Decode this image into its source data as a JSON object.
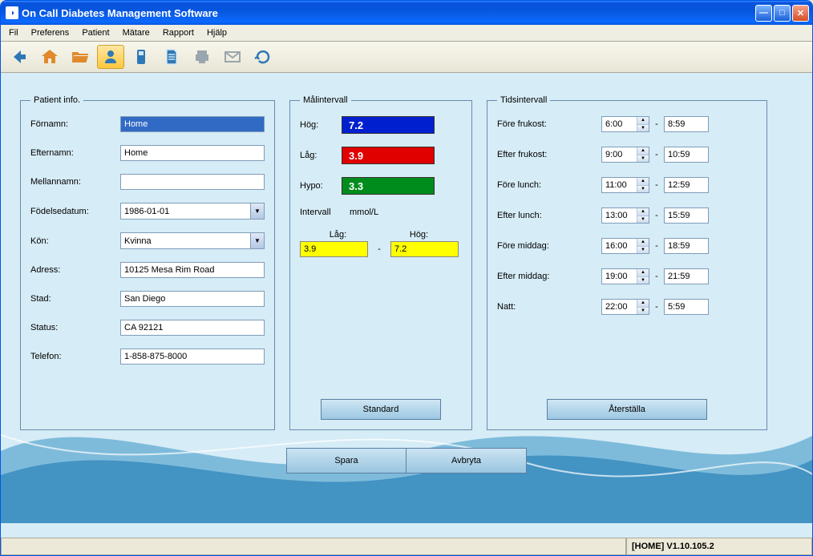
{
  "window": {
    "title": "On Call Diabetes Management Software"
  },
  "menu": {
    "fil": "Fil",
    "preferens": "Preferens",
    "patient": "Patient",
    "matare": "Mätare",
    "rapport": "Rapport",
    "hjalp": "Hjälp"
  },
  "groups": {
    "patient_info": "Patient info.",
    "target": "Målintervall",
    "time": "Tidsintervall"
  },
  "patient": {
    "labels": {
      "fornamn": "Förnamn:",
      "efternamn": "Efternamn:",
      "mellannamn": "Mellannamn:",
      "fodelsedatum": "Födelsedatum:",
      "kon": "Kön:",
      "adress": "Adress:",
      "stad": "Stad:",
      "status": "Status:",
      "telefon": "Telefon:"
    },
    "values": {
      "fornamn": "Home",
      "efternamn": "Home",
      "mellannamn": "",
      "fodelsedatum": "1986-01-01",
      "kon": "Kvinna",
      "adress": "10125 Mesa Rim Road",
      "stad": "San Diego",
      "status": "CA 92121",
      "telefon": "1-858-875-8000"
    }
  },
  "target": {
    "labels": {
      "hog": "Hög:",
      "lag": "Låg:",
      "hypo": "Hypo:",
      "intervall": "Intervall",
      "unit": "mmol/L",
      "lag2": "Låg:",
      "hog2": "Hög:",
      "standard": "Standard"
    },
    "values": {
      "hog": "7.2",
      "lag": "3.9",
      "hypo": "3.3",
      "yLag": "3.9",
      "yHog": "7.2"
    }
  },
  "time": {
    "labels": {
      "fore_frukost": "Före frukost:",
      "efter_frukost": "Efter frukost:",
      "fore_lunch": "Före lunch:",
      "efter_lunch": "Efter lunch:",
      "fore_middag": "Före middag:",
      "efter_middag": "Efter middag:",
      "natt": "Natt:",
      "reset": "Återställa"
    },
    "values": {
      "fore_frukost": {
        "from": "6:00",
        "to": "8:59"
      },
      "efter_frukost": {
        "from": "9:00",
        "to": "10:59"
      },
      "fore_lunch": {
        "from": "11:00",
        "to": "12:59"
      },
      "efter_lunch": {
        "from": "13:00",
        "to": "15:59"
      },
      "fore_middag": {
        "from": "16:00",
        "to": "18:59"
      },
      "efter_middag": {
        "from": "19:00",
        "to": "21:59"
      },
      "natt": {
        "from": "22:00",
        "to": "5:59"
      }
    }
  },
  "actions": {
    "spara": "Spara",
    "avbryta": "Avbryta"
  },
  "status": {
    "version": "[HOME] V1.10.105.2"
  }
}
